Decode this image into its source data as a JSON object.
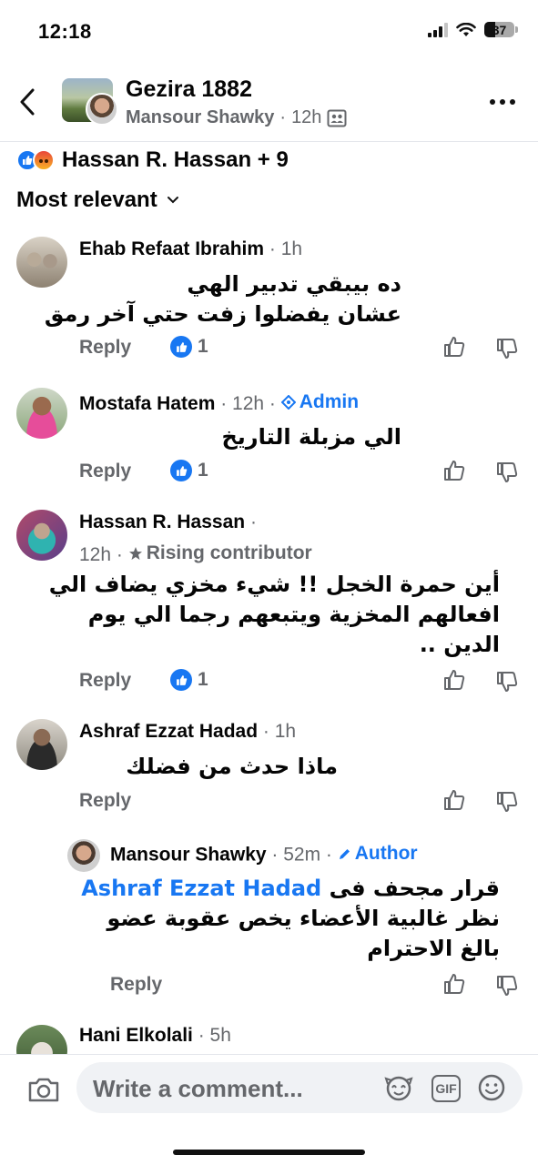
{
  "status_bar": {
    "time": "12:18",
    "battery": "37"
  },
  "header": {
    "title": "Gezira 1882",
    "author": "Mansour Shawky",
    "separator": "·",
    "time": "12h"
  },
  "reactions": {
    "summary": "Hassan R. Hassan + 9"
  },
  "sort": {
    "label": "Most relevant"
  },
  "comments": [
    {
      "name": "Ehab Refaat Ibrahim",
      "meta": "· 1h",
      "lines": [
        "ده بيبقي تدبير الهي",
        "عشان يفضلوا زفت حتي آخر رمق"
      ],
      "reply": "Reply",
      "likes": "1"
    },
    {
      "name": "Mostafa Hatem",
      "meta": "· 12h ·",
      "badge": "Admin",
      "lines": [
        "الي مزبلة التاريخ"
      ],
      "reply": "Reply",
      "likes": "1"
    },
    {
      "name": "Hassan R. Hassan",
      "meta": "·",
      "meta2": "12h ·",
      "badge": "Rising contributor",
      "lines": [
        "أين حمرة الخجل !! شيء مخزي يضاف الي",
        "افعالهم المخزية ويتبعهم رجما الي يوم",
        "الدين .."
      ],
      "reply": "Reply",
      "likes": "1"
    },
    {
      "name": "Ashraf Ezzat Hadad",
      "meta": "· 1h",
      "lines": [
        "ماذا حدث من فضلك"
      ],
      "reply": "Reply"
    },
    {
      "name": "Mansour Shawky",
      "meta": "· 52m ·",
      "badge": "Author",
      "mention": "Ashraf Ezzat Hadad",
      "line1_rest": "قرار مجحف فى",
      "lines": [
        "نظر غالبية الأعضاء يخص عقوبة عضو",
        "بالغ الاحترام"
      ],
      "reply": "Reply"
    },
    {
      "name": "Hani Elkolali",
      "meta": "· 5h"
    }
  ],
  "composer": {
    "placeholder": "Write a comment...",
    "gif_label": "GIF"
  }
}
